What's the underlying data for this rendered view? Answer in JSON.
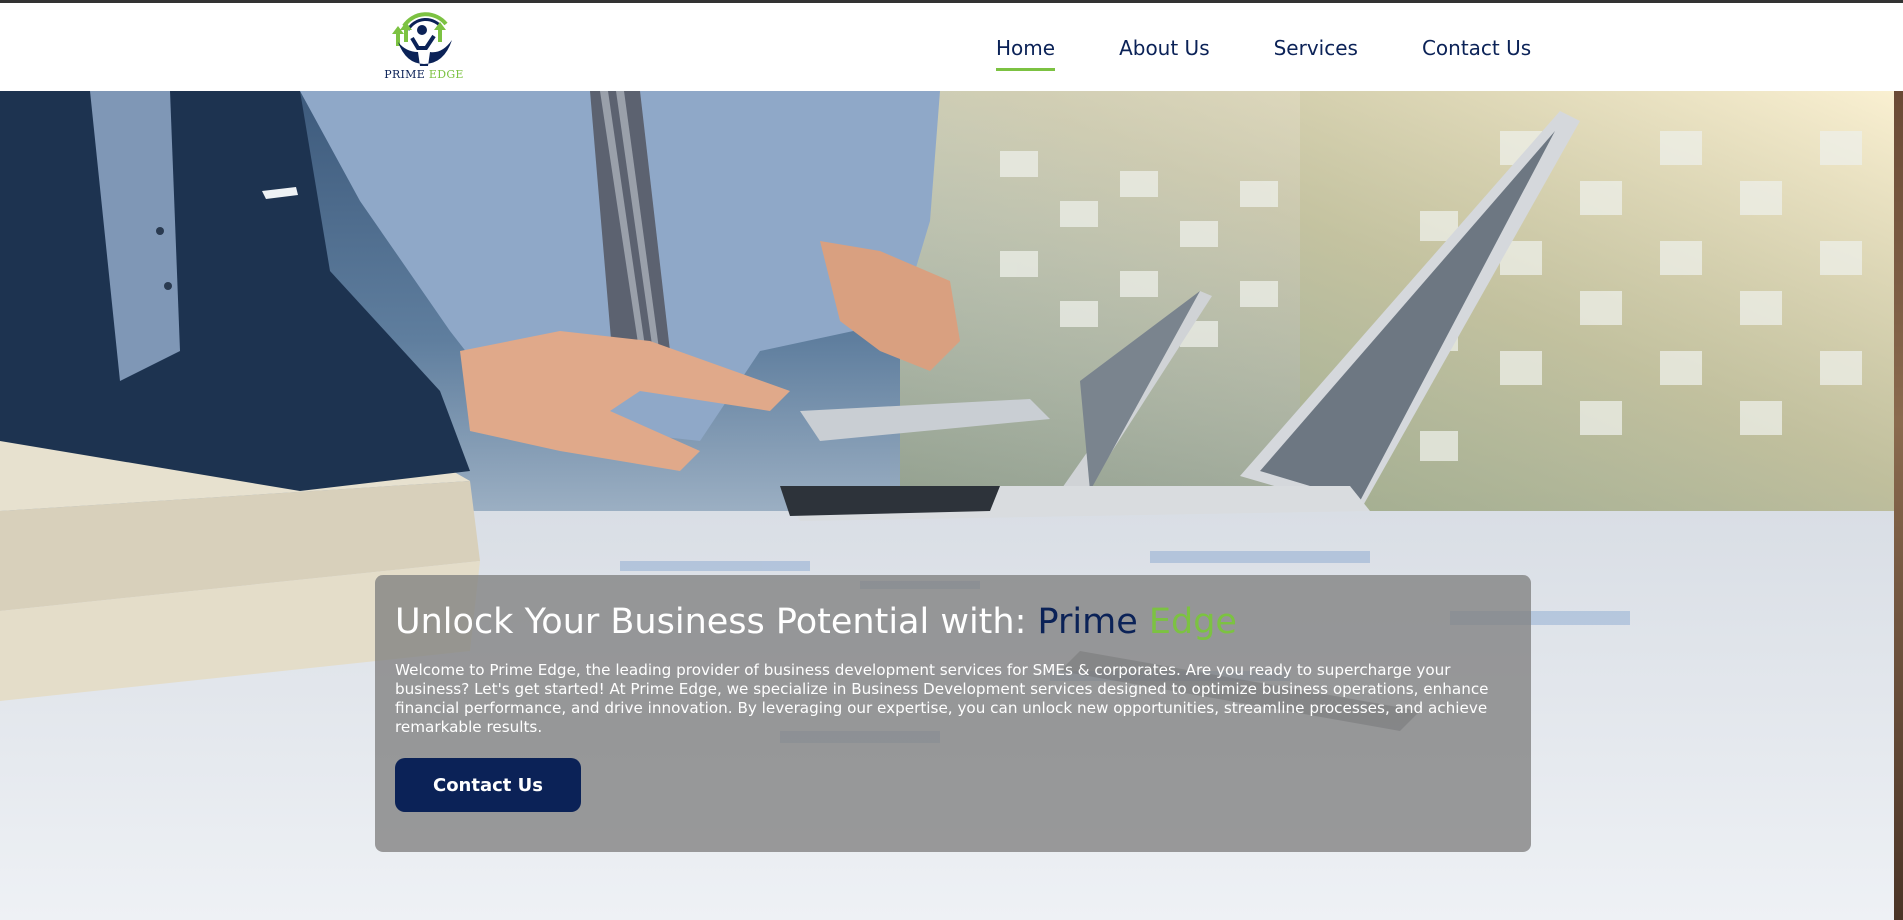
{
  "brand": {
    "logo_text_a": "PRIME",
    "logo_text_b": " EDGE",
    "colors": {
      "navy": "#0b2257",
      "green": "#7cc242"
    }
  },
  "nav": {
    "items": [
      {
        "label": "Home",
        "active": true
      },
      {
        "label": "About Us",
        "active": false
      },
      {
        "label": "Services",
        "active": false
      },
      {
        "label": "Contact Us",
        "active": false
      }
    ]
  },
  "hero": {
    "headline_prefix": "Unlock Your Business Potential with: ",
    "headline_brand_a": "Prime",
    "headline_brand_b": " Edge",
    "body": "Welcome to Prime Edge, the leading provider of business development services for SMEs & corporates. Are you ready to supercharge your business? Let's get started! At Prime Edge, we specialize in Business Development services designed to optimize business operations, enhance financial performance, and drive innovation. By leveraging our expertise, you can unlock new opportunities, streamline processes, and achieve remarkable results.",
    "cta_label": "Contact Us"
  }
}
